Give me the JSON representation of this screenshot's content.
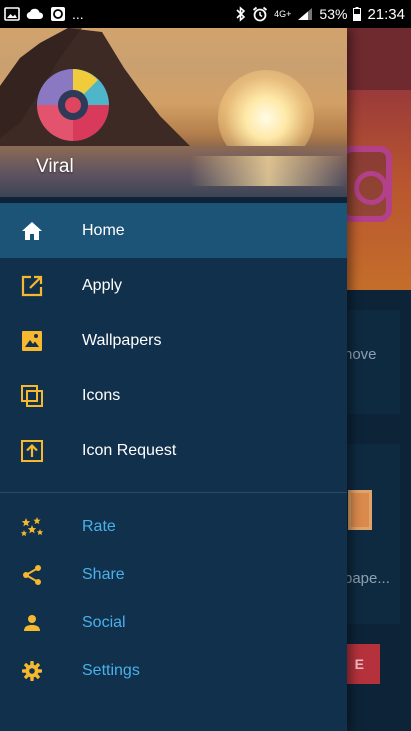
{
  "status_bar": {
    "notif_more": "...",
    "network": "4G+",
    "battery": "53%",
    "time": "21:34"
  },
  "drawer": {
    "app_name": "Viral",
    "primary_items": [
      {
        "label": "Home",
        "icon": "home-icon",
        "active": true
      },
      {
        "label": "Apply",
        "icon": "launch-icon"
      },
      {
        "label": "Wallpapers",
        "icon": "image-icon"
      },
      {
        "label": "Icons",
        "icon": "copy-icon"
      },
      {
        "label": "Icon Request",
        "icon": "upload-icon"
      }
    ],
    "secondary_items": [
      {
        "label": "Rate",
        "icon": "stars-icon"
      },
      {
        "label": "Share",
        "icon": "share-icon"
      },
      {
        "label": "Social",
        "icon": "person-icon"
      },
      {
        "label": "Settings",
        "icon": "settings-icon"
      }
    ]
  },
  "background": {
    "text1": "nove",
    "text2": "pape...",
    "button": "E"
  },
  "colors": {
    "accent": "#f5b82e",
    "active_bg": "#1c5478",
    "drawer_bg": "#11304b",
    "secondary_text": "#4ab0ea"
  }
}
